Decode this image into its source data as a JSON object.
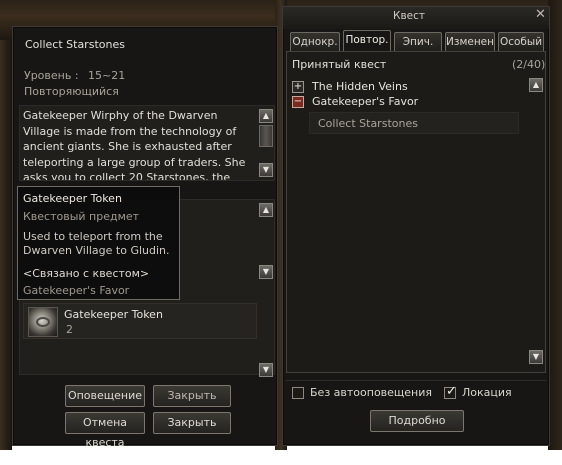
{
  "quest_detail": {
    "title": "Collect Starstones",
    "level_label": "Уровень :",
    "level_value": "15~21",
    "repeat_label": "Повторяющийся",
    "description": "Gatekeeper Wirphy of the Dwarven Village is made from the technology of ancient giants. She is exhausted after teleporting a large group of traders. She asks you to collect 20 Starstones, the ancient giants' source of",
    "reward_item": {
      "name": "Gatekeeper Token",
      "count": "2"
    },
    "buttons": {
      "notify": "Оповещение",
      "close1": "Закрыть",
      "cancel_quest": "Отмена квеста",
      "close2": "Закрыть"
    }
  },
  "tooltip": {
    "name": "Gatekeeper Token",
    "type": "Квестовый предмет",
    "description": "Used to teleport from the Dwarven Village to Gludin.",
    "related_header": "<Связано с квестом>",
    "related_quest": "Gatekeeper's Favor"
  },
  "quest_window": {
    "title": "Квест",
    "tabs": [
      "Однокр.",
      "Повтор.",
      "Эпич.",
      "Изменен.",
      "Особый"
    ],
    "active_tab_index": 1,
    "accepted_label": "Принятый квест",
    "accepted_count": "(2/40)",
    "quests": [
      {
        "name": "The Hidden Veins",
        "expanded": false
      },
      {
        "name": "Gatekeeper's Favor",
        "expanded": true,
        "subquest": "Collect Starstones"
      }
    ],
    "no_auto_notify": "Без автооповещения",
    "location": "Локация",
    "details_button": "Подробно"
  }
}
